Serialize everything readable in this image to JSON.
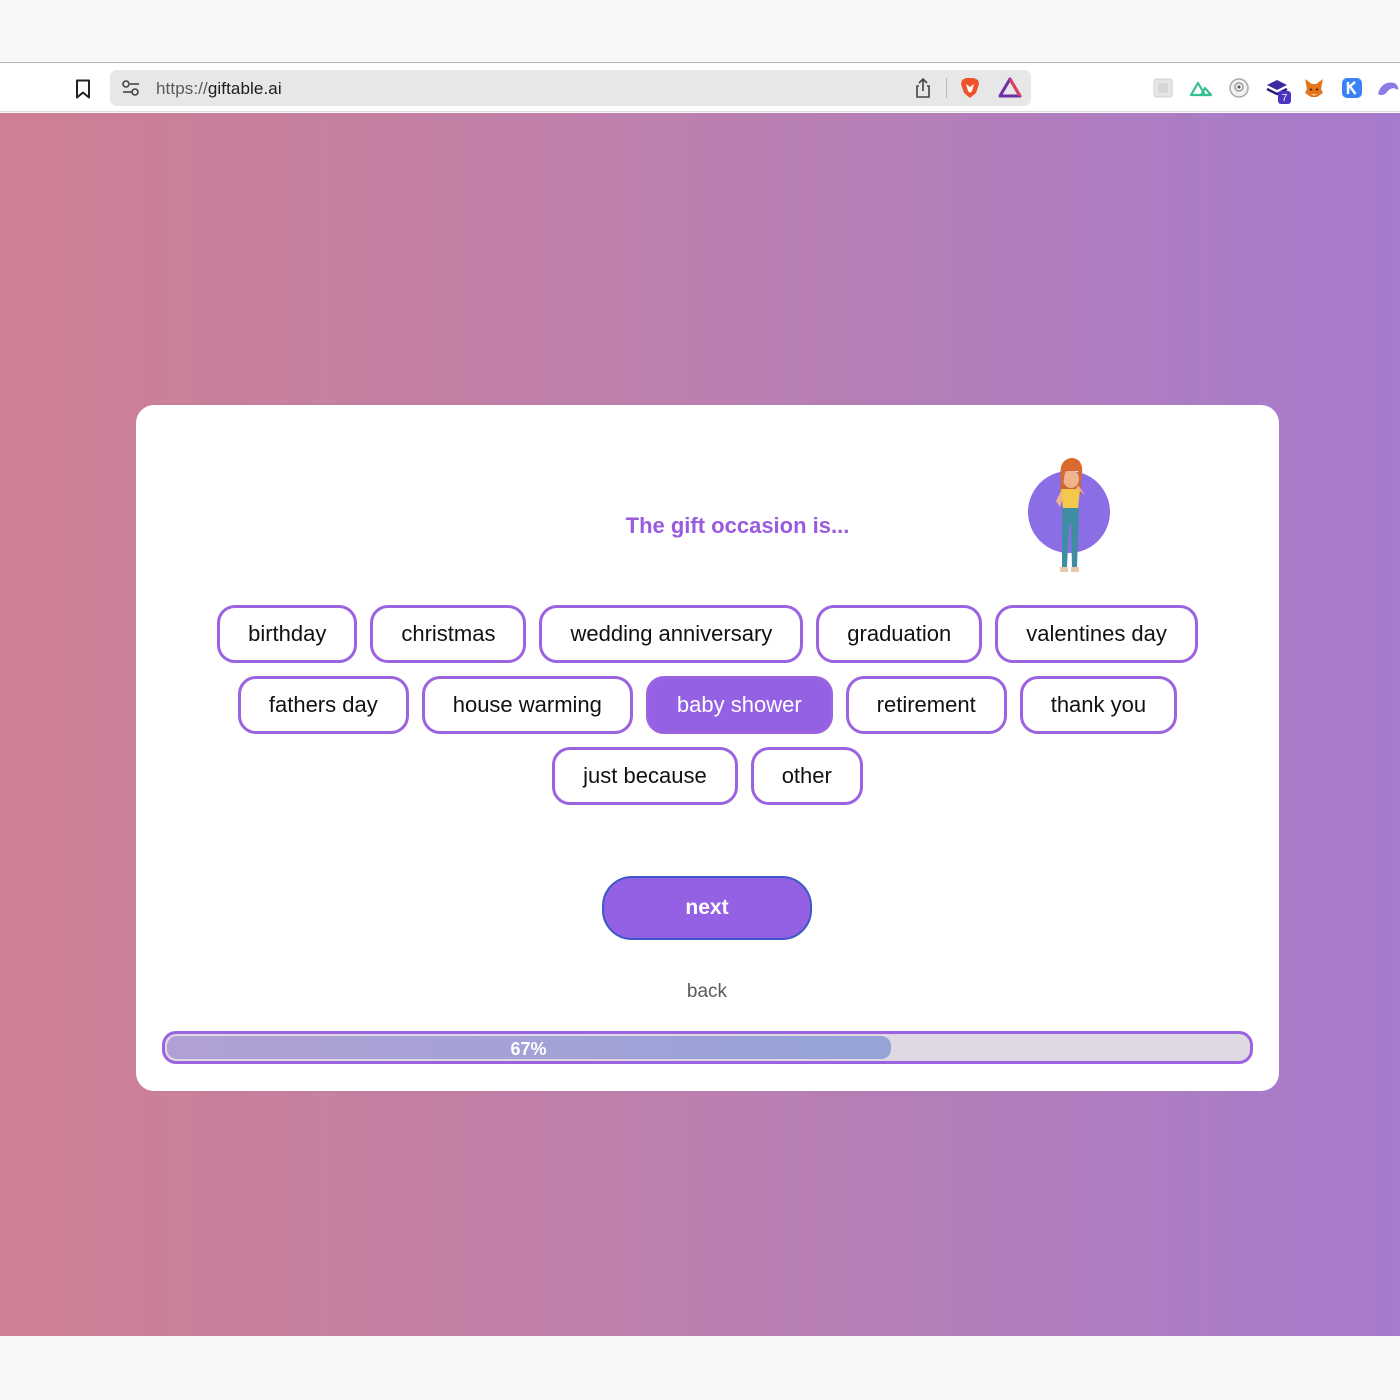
{
  "browser": {
    "url_scheme": "https://",
    "url_host": "giftable.ai",
    "extensions": [
      {
        "name": "extension-placeholder-icon",
        "color": "#cfcfcf"
      },
      {
        "name": "nuxt-devtools-icon",
        "color": "#35c08f"
      },
      {
        "name": "eye-extension-icon",
        "color": "#9a9a9a"
      },
      {
        "name": "stack-extension-icon",
        "color": "#3d2a9e",
        "badge": "7"
      },
      {
        "name": "metamask-fox-icon",
        "color": "#e2761b"
      },
      {
        "name": "k-extension-icon",
        "color": "#3b82f6"
      },
      {
        "name": "bird-extension-icon",
        "color": "#8c7ae6"
      }
    ]
  },
  "quiz": {
    "question": "The gift occasion is...",
    "options": [
      {
        "label": "birthday",
        "selected": false
      },
      {
        "label": "christmas",
        "selected": false
      },
      {
        "label": "wedding anniversary",
        "selected": false
      },
      {
        "label": "graduation",
        "selected": false
      },
      {
        "label": "valentines day",
        "selected": false
      },
      {
        "label": "fathers day",
        "selected": false
      },
      {
        "label": "house warming",
        "selected": false
      },
      {
        "label": "baby shower",
        "selected": true
      },
      {
        "label": "retirement",
        "selected": false
      },
      {
        "label": "thank you",
        "selected": false
      },
      {
        "label": "just because",
        "selected": false
      },
      {
        "label": "other",
        "selected": false
      }
    ],
    "next_label": "next",
    "back_label": "back",
    "progress": {
      "percent": 67,
      "label": "67%"
    }
  },
  "colors": {
    "accent": "#9461e4",
    "question": "#9a5bde",
    "gradient_start": "#cf7f93",
    "gradient_end": "#a67acc"
  }
}
